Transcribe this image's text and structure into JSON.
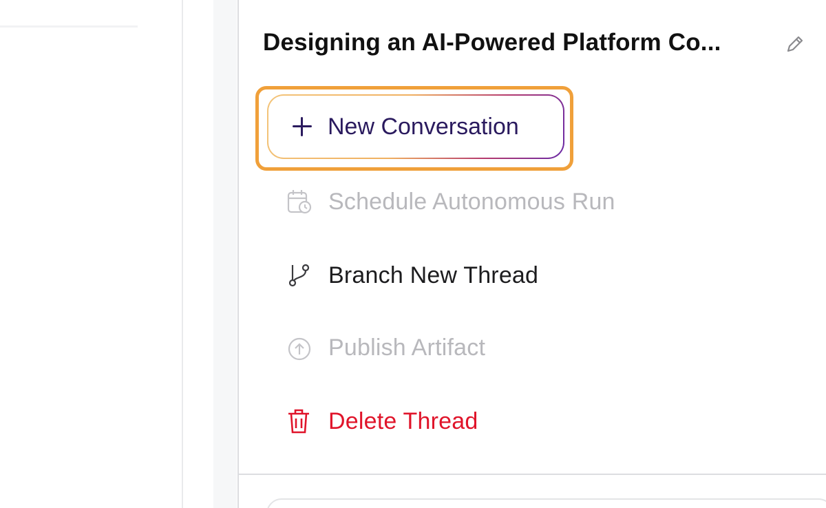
{
  "panel": {
    "title": "Designing an AI-Powered Platform Co...",
    "edit_icon": "pencil-icon"
  },
  "actions": {
    "new_conversation": {
      "label": "New Conversation",
      "icon": "plus-icon",
      "focused": true
    },
    "schedule": {
      "label": "Schedule Autonomous Run",
      "icon": "calendar-clock-icon",
      "disabled": true
    },
    "branch": {
      "label": "Branch New Thread",
      "icon": "branch-icon",
      "disabled": false
    },
    "publish": {
      "label": "Publish Artifact",
      "icon": "upload-circle-icon",
      "disabled": true
    },
    "delete": {
      "label": "Delete Thread",
      "icon": "trash-icon",
      "danger": true
    }
  },
  "colors": {
    "focus_ring": "#f0a03a",
    "primary_text": "#2a1a5e",
    "disabled_text": "#b8b8bc",
    "danger": "#e0142a",
    "gradient_start": "#f3c47a",
    "gradient_end": "#6a2aa6"
  }
}
